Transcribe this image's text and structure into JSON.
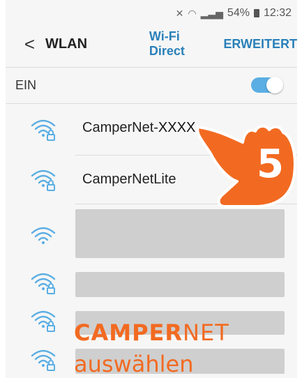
{
  "status": {
    "battery_pct": "54%",
    "time": "12:32"
  },
  "appbar": {
    "back": "<",
    "title": "WLAN",
    "actions": [
      "Wi-Fi Direct",
      "ERWEITERT"
    ]
  },
  "toggle": {
    "label": "EIN",
    "on": true
  },
  "networks": [
    {
      "name_prefix": "CamperNet-",
      "name_suffix": "XXXX",
      "secured": true
    },
    {
      "name": "CamperNetLite",
      "secured": true
    },
    {
      "name": "",
      "secured": false,
      "obscured": true
    },
    {
      "name": "",
      "secured": true,
      "obscured": true
    },
    {
      "name": "",
      "secured": true,
      "obscured": true
    },
    {
      "name": "",
      "secured": true,
      "obscured": true
    }
  ],
  "overlay": {
    "step_number": "5",
    "caption_bold": "CAMPER",
    "caption_regular": "NET",
    "caption_line2": "auswählen",
    "accent_color": "#f26a21"
  }
}
